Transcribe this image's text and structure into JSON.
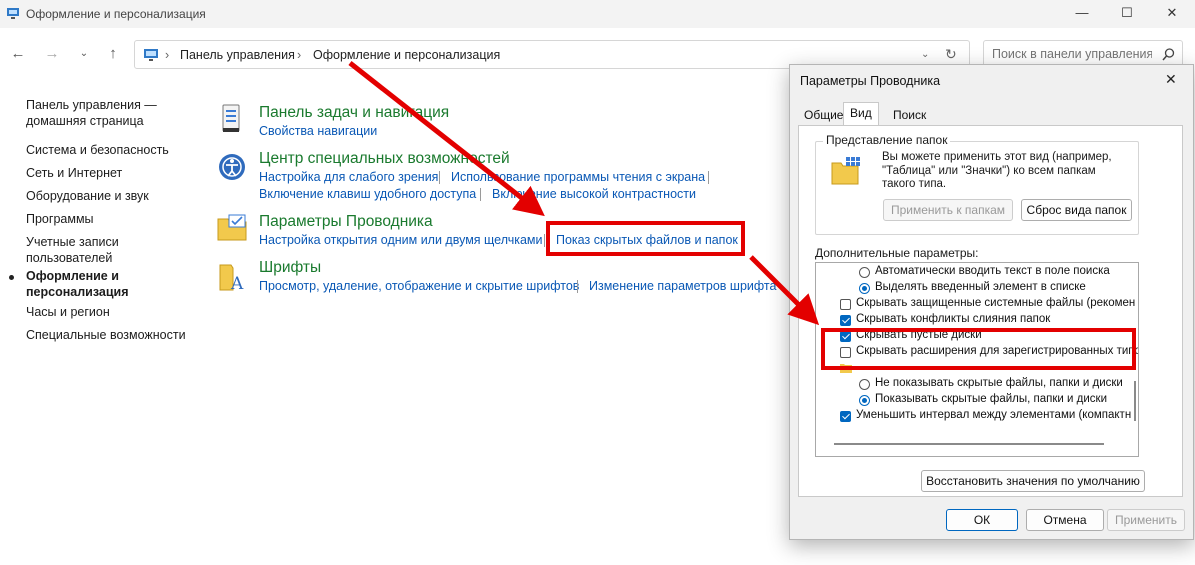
{
  "window": {
    "title": "Оформление и персонализация",
    "controls": [
      "minimize-icon",
      "maximize-icon",
      "close-icon"
    ]
  },
  "address_bar": {
    "breadcrumb": [
      "Панель управления",
      "Оформление и персонализация"
    ],
    "search_placeholder": "Поиск в панели управления"
  },
  "sidebar": {
    "items": [
      {
        "label": "Панель управления — домашняя страница"
      },
      {
        "label": "Система и безопасность"
      },
      {
        "label": "Сеть и Интернет"
      },
      {
        "label": "Оборудование и звук"
      },
      {
        "label": "Программы"
      },
      {
        "label": "Учетные записи пользователей"
      },
      {
        "label": "Оформление и персонализация",
        "active": true
      },
      {
        "label": "Часы и регион"
      },
      {
        "label": "Специальные возможности"
      }
    ]
  },
  "categories": [
    {
      "title": "Панель задач и навигация",
      "links": [
        "Свойства навигации"
      ]
    },
    {
      "title": "Центр специальных возможностей",
      "links": [
        "Настройка для слабого зрения",
        "Использование программы чтения с экрана",
        "Включение клавиш удобного доступа",
        "Включение высокой контрастности"
      ]
    },
    {
      "title": "Параметры Проводника",
      "links": [
        "Настройка открытия одним или двумя щелчками",
        "Показ скрытых файлов и папок"
      ]
    },
    {
      "title": "Шрифты",
      "links": [
        "Просмотр, удаление, отображение и скрытие шрифтов",
        "Изменение параметров шрифта"
      ]
    }
  ],
  "dialog": {
    "title": "Параметры Проводника",
    "tabs": [
      "Общие",
      "Вид",
      "Поиск"
    ],
    "active_tab": "Вид",
    "folder_view": {
      "group_label": "Представление папок",
      "description": "Вы можете применить этот вид (например, \"Таблица\" или \"Значки\") ко всем папкам такого типа.",
      "apply_button": "Применить к папкам",
      "reset_button": "Сброс вида папок"
    },
    "advanced_label": "Дополнительные параметры:",
    "options": [
      {
        "type": "radio",
        "checked": false,
        "label": "Автоматически вводить текст в поле поиска"
      },
      {
        "type": "radio",
        "checked": true,
        "label": "Выделять введенный элемент в списке"
      },
      {
        "type": "checkbox",
        "checked": false,
        "label": "Скрывать защищенные системные файлы (рекомен"
      },
      {
        "type": "checkbox",
        "checked": true,
        "label": "Скрывать конфликты слияния папок"
      },
      {
        "type": "checkbox",
        "checked": true,
        "label": "Скрывать пустые диски"
      },
      {
        "type": "checkbox",
        "checked": false,
        "label": "Скрывать расширения для зарегистрированных типо"
      },
      {
        "type": "radio",
        "checked": false,
        "label": "Не показывать скрытые файлы, папки и диски"
      },
      {
        "type": "radio",
        "checked": true,
        "label": "Показывать скрытые файлы, папки и диски"
      },
      {
        "type": "checkbox",
        "checked": true,
        "label": "Уменьшить интервал между элементами (компактн"
      }
    ],
    "restore_button": "Восстановить значения по умолчанию",
    "ok_button": "ОК",
    "cancel_button": "Отмена",
    "apply_button": "Применить"
  },
  "colors": {
    "accent": "#0067c0",
    "annotation": "#e30000",
    "category_title": "#1a7a2e",
    "link": "#0a58b5"
  }
}
